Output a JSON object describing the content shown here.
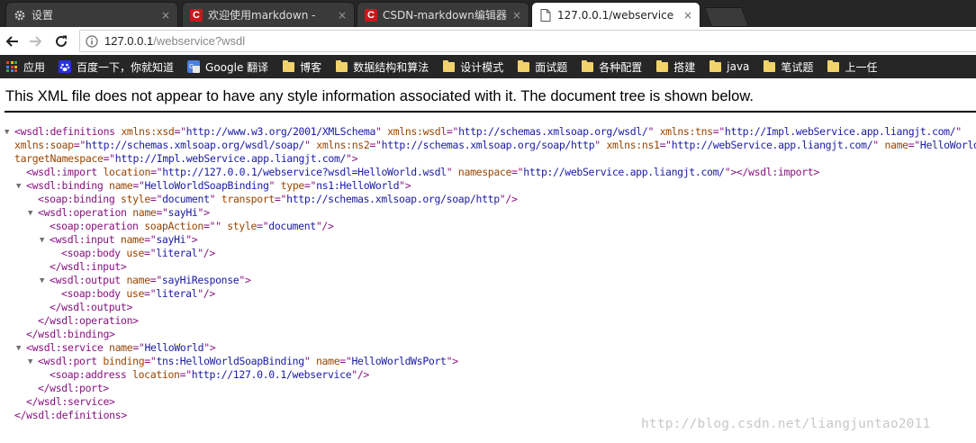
{
  "browser": {
    "tabs": [
      {
        "label": "设置",
        "icon": "gear-icon",
        "active": false
      },
      {
        "label": "欢迎使用markdown -",
        "icon": "csdn-icon",
        "active": false
      },
      {
        "label": "CSDN-markdown编辑器",
        "icon": "csdn-icon",
        "active": false
      },
      {
        "label": "127.0.0.1/webservice",
        "icon": "page-icon",
        "active": true
      }
    ],
    "csdn_badge_letter": "C",
    "tab_close_glyph": "×",
    "url": {
      "host": "127.0.0.1",
      "path": "/webservice?wsdl"
    },
    "bookmarks": [
      {
        "label": "应用",
        "icon": "apps-grid-icon"
      },
      {
        "label": "百度一下，你就知道",
        "icon": "baidu-icon"
      },
      {
        "label": "Google 翻译",
        "icon": "google-translate-icon"
      },
      {
        "label": "博客",
        "icon": "folder-icon"
      },
      {
        "label": "数据结构和算法",
        "icon": "folder-icon"
      },
      {
        "label": "设计模式",
        "icon": "folder-icon"
      },
      {
        "label": "面试题",
        "icon": "folder-icon"
      },
      {
        "label": "各种配置",
        "icon": "folder-icon"
      },
      {
        "label": "搭建",
        "icon": "folder-icon"
      },
      {
        "label": "java",
        "icon": "folder-icon"
      },
      {
        "label": "笔试题",
        "icon": "folder-icon"
      },
      {
        "label": "上一任",
        "icon": "folder-icon"
      }
    ]
  },
  "page": {
    "notice": "This XML file does not appear to have any style information associated with it. The document tree is shown below.",
    "xml_lines": [
      {
        "indent": 0,
        "toggle": true,
        "parts": [
          [
            "t",
            "<wsdl:definitions "
          ],
          [
            "a",
            "xmlns:xsd"
          ],
          [
            "t",
            "=\""
          ],
          [
            "v",
            "http://www.w3.org/2001/XMLSchema"
          ],
          [
            "t",
            "\" "
          ],
          [
            "a",
            "xmlns:wsdl"
          ],
          [
            "t",
            "=\""
          ],
          [
            "v",
            "http://schemas.xmlsoap.org/wsdl/"
          ],
          [
            "t",
            "\" "
          ],
          [
            "a",
            "xmlns:tns"
          ],
          [
            "t",
            "=\""
          ],
          [
            "v",
            "http://Impl.webService.app.liangjt.com/"
          ],
          [
            "t",
            "\""
          ]
        ]
      },
      {
        "indent": 0,
        "wrap": true,
        "parts": [
          [
            "a",
            "xmlns:soap"
          ],
          [
            "t",
            "=\""
          ],
          [
            "v",
            "http://schemas.xmlsoap.org/wsdl/soap/"
          ],
          [
            "t",
            "\" "
          ],
          [
            "a",
            "xmlns:ns2"
          ],
          [
            "t",
            "=\""
          ],
          [
            "v",
            "http://schemas.xmlsoap.org/soap/http"
          ],
          [
            "t",
            "\" "
          ],
          [
            "a",
            "xmlns:ns1"
          ],
          [
            "t",
            "=\""
          ],
          [
            "v",
            "http://webService.app.liangjt.com/"
          ],
          [
            "t",
            "\" "
          ],
          [
            "a",
            "name"
          ],
          [
            "t",
            "=\""
          ],
          [
            "v",
            "HelloWorld"
          ],
          [
            "t",
            "\""
          ]
        ]
      },
      {
        "indent": 0,
        "wrap": true,
        "parts": [
          [
            "a",
            "targetNamespace"
          ],
          [
            "t",
            "=\""
          ],
          [
            "v",
            "http://Impl.webService.app.liangjt.com/"
          ],
          [
            "t",
            "\">"
          ]
        ]
      },
      {
        "indent": 1,
        "parts": [
          [
            "t",
            "<wsdl:import "
          ],
          [
            "a",
            "location"
          ],
          [
            "t",
            "=\""
          ],
          [
            "v",
            "http://127.0.0.1/webservice?wsdl=HelloWorld.wsdl"
          ],
          [
            "t",
            "\" "
          ],
          [
            "a",
            "namespace"
          ],
          [
            "t",
            "=\""
          ],
          [
            "v",
            "http://webService.app.liangjt.com/"
          ],
          [
            "t",
            "\"></wsdl:import>"
          ]
        ]
      },
      {
        "indent": 1,
        "toggle": true,
        "parts": [
          [
            "t",
            "<wsdl:binding "
          ],
          [
            "a",
            "name"
          ],
          [
            "t",
            "=\""
          ],
          [
            "v",
            "HelloWorldSoapBinding"
          ],
          [
            "t",
            "\" "
          ],
          [
            "a",
            "type"
          ],
          [
            "t",
            "=\""
          ],
          [
            "v",
            "ns1:HelloWorld"
          ],
          [
            "t",
            "\">"
          ]
        ]
      },
      {
        "indent": 2,
        "parts": [
          [
            "t",
            "<soap:binding "
          ],
          [
            "a",
            "style"
          ],
          [
            "t",
            "=\""
          ],
          [
            "v",
            "document"
          ],
          [
            "t",
            "\" "
          ],
          [
            "a",
            "transport"
          ],
          [
            "t",
            "=\""
          ],
          [
            "v",
            "http://schemas.xmlsoap.org/soap/http"
          ],
          [
            "t",
            "\"/>"
          ]
        ]
      },
      {
        "indent": 2,
        "toggle": true,
        "parts": [
          [
            "t",
            "<wsdl:operation "
          ],
          [
            "a",
            "name"
          ],
          [
            "t",
            "=\""
          ],
          [
            "v",
            "sayHi"
          ],
          [
            "t",
            "\">"
          ]
        ]
      },
      {
        "indent": 3,
        "parts": [
          [
            "t",
            "<soap:operation "
          ],
          [
            "a",
            "soapAction"
          ],
          [
            "t",
            "=\"\" "
          ],
          [
            "a",
            "style"
          ],
          [
            "t",
            "=\""
          ],
          [
            "v",
            "document"
          ],
          [
            "t",
            "\"/>"
          ]
        ]
      },
      {
        "indent": 3,
        "toggle": true,
        "parts": [
          [
            "t",
            "<wsdl:input "
          ],
          [
            "a",
            "name"
          ],
          [
            "t",
            "=\""
          ],
          [
            "v",
            "sayHi"
          ],
          [
            "t",
            "\">"
          ]
        ]
      },
      {
        "indent": 4,
        "parts": [
          [
            "t",
            "<soap:body "
          ],
          [
            "a",
            "use"
          ],
          [
            "t",
            "=\""
          ],
          [
            "v",
            "literal"
          ],
          [
            "t",
            "\"/>"
          ]
        ]
      },
      {
        "indent": 3,
        "parts": [
          [
            "t",
            "</wsdl:input>"
          ]
        ]
      },
      {
        "indent": 3,
        "toggle": true,
        "parts": [
          [
            "t",
            "<wsdl:output "
          ],
          [
            "a",
            "name"
          ],
          [
            "t",
            "=\""
          ],
          [
            "v",
            "sayHiResponse"
          ],
          [
            "t",
            "\">"
          ]
        ]
      },
      {
        "indent": 4,
        "parts": [
          [
            "t",
            "<soap:body "
          ],
          [
            "a",
            "use"
          ],
          [
            "t",
            "=\""
          ],
          [
            "v",
            "literal"
          ],
          [
            "t",
            "\"/>"
          ]
        ]
      },
      {
        "indent": 3,
        "parts": [
          [
            "t",
            "</wsdl:output>"
          ]
        ]
      },
      {
        "indent": 2,
        "parts": [
          [
            "t",
            "</wsdl:operation>"
          ]
        ]
      },
      {
        "indent": 1,
        "parts": [
          [
            "t",
            "</wsdl:binding>"
          ]
        ]
      },
      {
        "indent": 1,
        "toggle": true,
        "parts": [
          [
            "t",
            "<wsdl:service "
          ],
          [
            "a",
            "name"
          ],
          [
            "t",
            "=\""
          ],
          [
            "v",
            "HelloWorld"
          ],
          [
            "t",
            "\">"
          ]
        ]
      },
      {
        "indent": 2,
        "toggle": true,
        "parts": [
          [
            "t",
            "<wsdl:port "
          ],
          [
            "a",
            "binding"
          ],
          [
            "t",
            "=\""
          ],
          [
            "v",
            "tns:HelloWorldSoapBinding"
          ],
          [
            "t",
            "\" "
          ],
          [
            "a",
            "name"
          ],
          [
            "t",
            "=\""
          ],
          [
            "v",
            "HelloWorldWsPort"
          ],
          [
            "t",
            "\">"
          ]
        ]
      },
      {
        "indent": 3,
        "parts": [
          [
            "t",
            "<soap:address "
          ],
          [
            "a",
            "location"
          ],
          [
            "t",
            "=\""
          ],
          [
            "v",
            "http://127.0.0.1/webservice"
          ],
          [
            "t",
            "\"/>"
          ]
        ]
      },
      {
        "indent": 2,
        "parts": [
          [
            "t",
            "</wsdl:port>"
          ]
        ]
      },
      {
        "indent": 1,
        "parts": [
          [
            "t",
            "</wsdl:service>"
          ]
        ]
      },
      {
        "indent": 0,
        "parts": [
          [
            "t",
            "</wsdl:definitions>"
          ]
        ]
      }
    ],
    "toggle_glyph": "▼",
    "watermark": "http://blog.csdn.net/liangjuntao2011"
  },
  "colors": {
    "tag": "#881280",
    "attr_name": "#994500",
    "attr_value": "#1a1aa6",
    "chrome_dark": "#262626",
    "csdn_red": "#c9181b",
    "folder": "#f2d36b"
  }
}
